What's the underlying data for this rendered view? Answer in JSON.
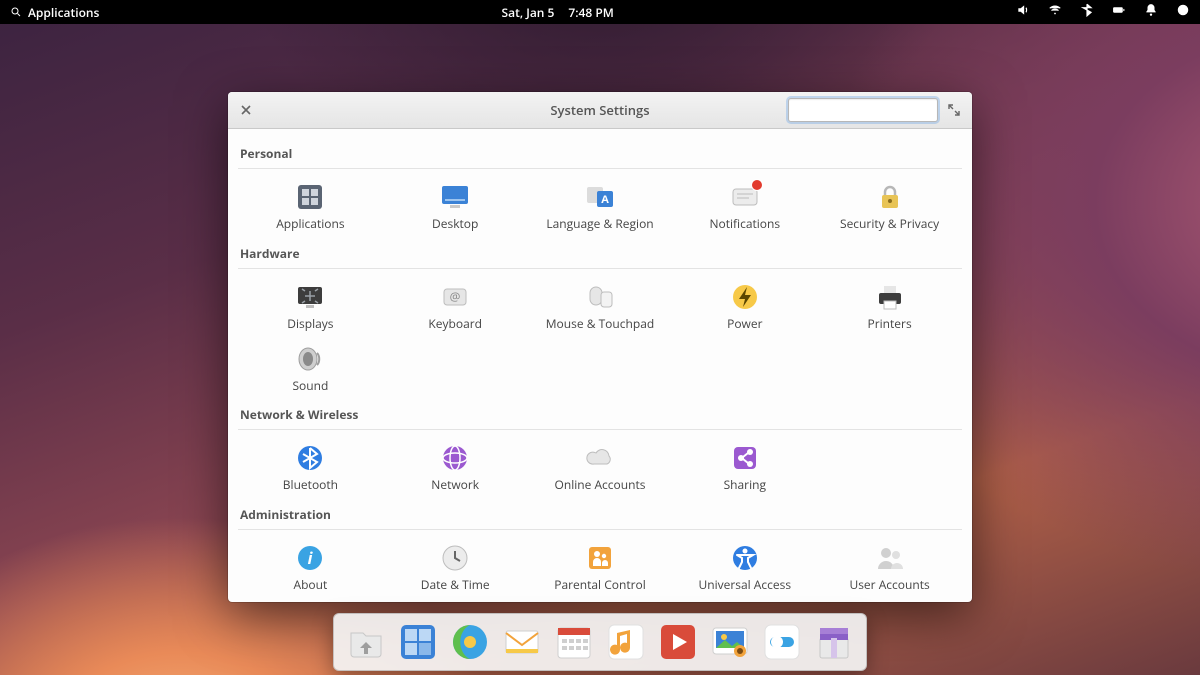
{
  "panel": {
    "apps_label": "Applications",
    "date": "Sat, Jan  5",
    "time": "7:48 PM"
  },
  "window": {
    "title": "System Settings",
    "search_placeholder": ""
  },
  "sections": {
    "personal": {
      "title": "Personal",
      "items": [
        {
          "label": "Applications",
          "icon": "applications-icon"
        },
        {
          "label": "Desktop",
          "icon": "desktop-icon"
        },
        {
          "label": "Language & Region",
          "icon": "language-icon"
        },
        {
          "label": "Notifications",
          "icon": "notifications-icon",
          "badge": true
        },
        {
          "label": "Security & Privacy",
          "icon": "lock-icon"
        }
      ]
    },
    "hardware": {
      "title": "Hardware",
      "items": [
        {
          "label": "Displays",
          "icon": "displays-icon"
        },
        {
          "label": "Keyboard",
          "icon": "keyboard-icon"
        },
        {
          "label": "Mouse & Touchpad",
          "icon": "mouse-icon"
        },
        {
          "label": "Power",
          "icon": "power-icon"
        },
        {
          "label": "Printers",
          "icon": "printer-icon"
        },
        {
          "label": "Sound",
          "icon": "sound-icon"
        }
      ]
    },
    "network": {
      "title": "Network & Wireless",
      "items": [
        {
          "label": "Bluetooth",
          "icon": "bluetooth-pref-icon"
        },
        {
          "label": "Network",
          "icon": "network-icon"
        },
        {
          "label": "Online Accounts",
          "icon": "cloud-icon"
        },
        {
          "label": "Sharing",
          "icon": "sharing-icon"
        }
      ]
    },
    "admin": {
      "title": "Administration",
      "items": [
        {
          "label": "About",
          "icon": "about-icon"
        },
        {
          "label": "Date & Time",
          "icon": "datetime-icon"
        },
        {
          "label": "Parental Control",
          "icon": "parental-icon"
        },
        {
          "label": "Universal Access",
          "icon": "a11y-icon"
        },
        {
          "label": "User Accounts",
          "icon": "users-icon"
        }
      ]
    }
  },
  "dock": [
    {
      "name": "files",
      "icon": "dock-files-icon"
    },
    {
      "name": "multitasking",
      "icon": "dock-multitask-icon"
    },
    {
      "name": "web",
      "icon": "dock-web-icon"
    },
    {
      "name": "mail",
      "icon": "dock-mail-icon"
    },
    {
      "name": "calendar",
      "icon": "dock-calendar-icon"
    },
    {
      "name": "music",
      "icon": "dock-music-icon"
    },
    {
      "name": "videos",
      "icon": "dock-videos-icon"
    },
    {
      "name": "photos",
      "icon": "dock-photos-icon"
    },
    {
      "name": "settings",
      "icon": "dock-settings-icon"
    },
    {
      "name": "appcenter",
      "icon": "dock-appcenter-icon"
    }
  ]
}
